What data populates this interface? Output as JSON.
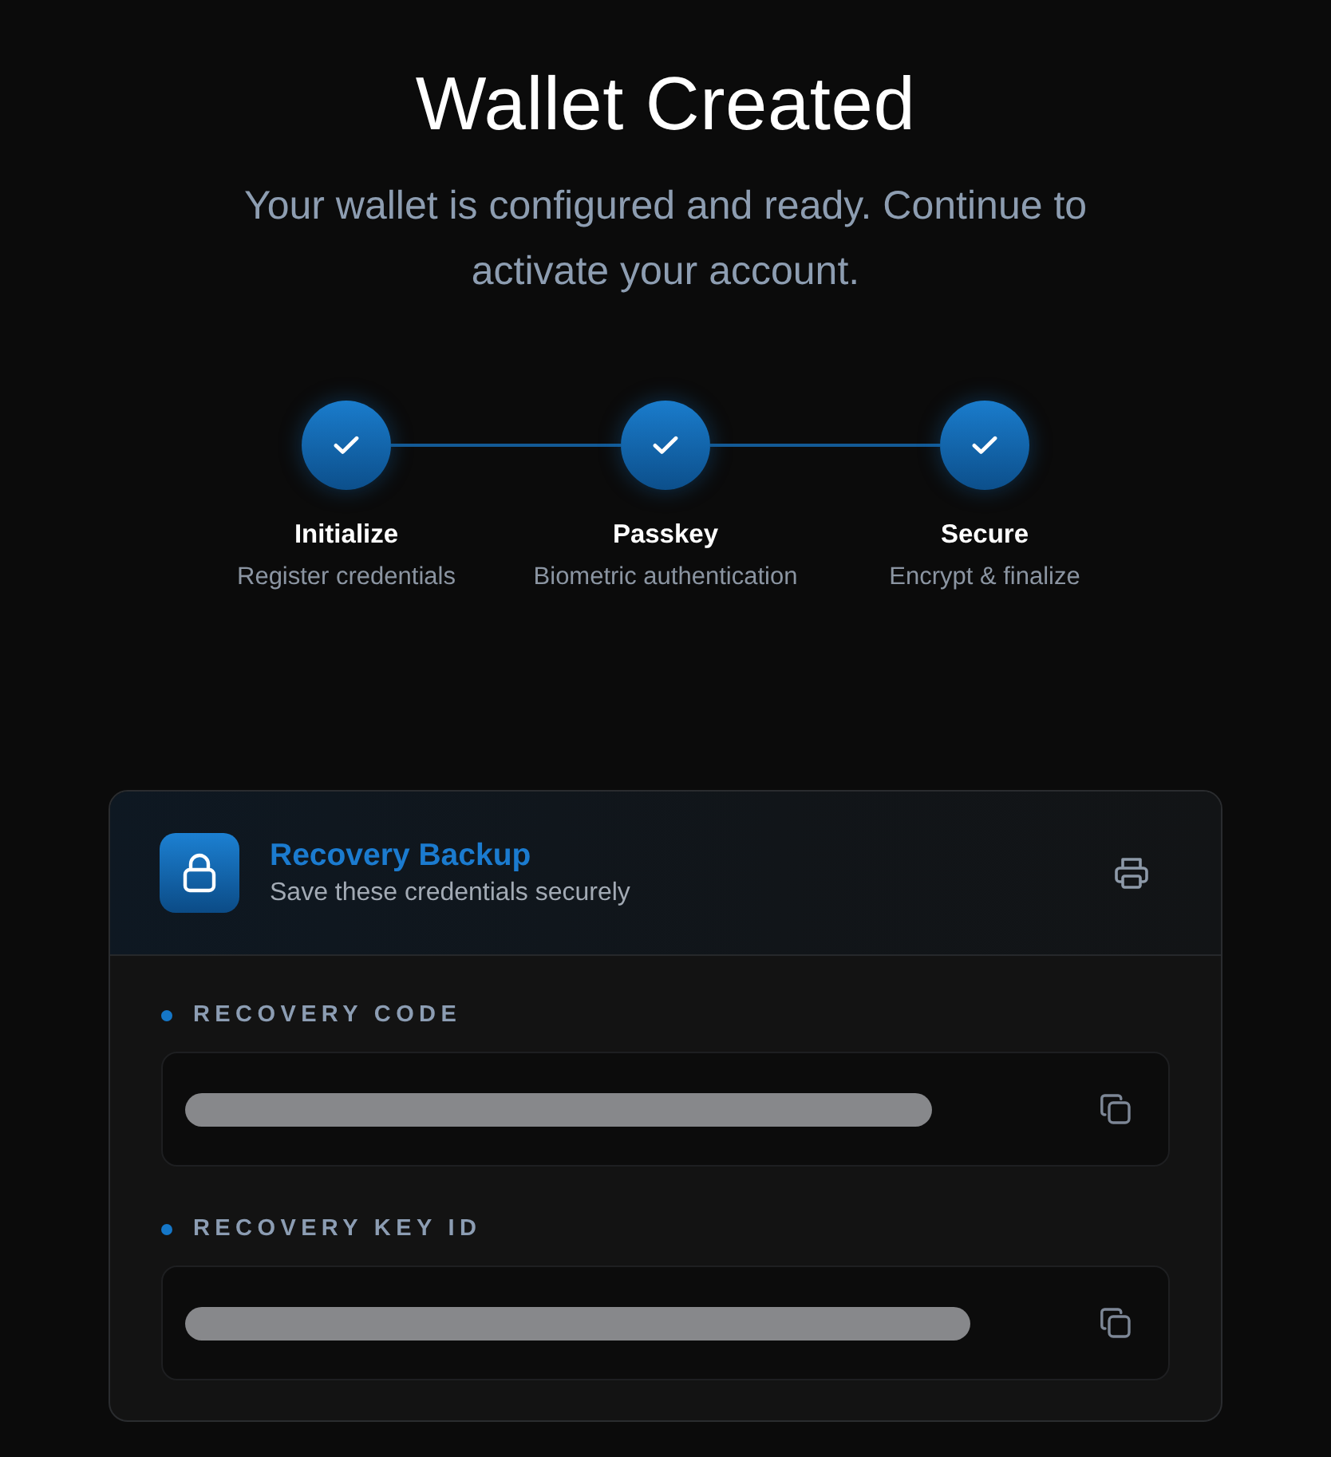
{
  "header": {
    "title": "Wallet Created",
    "subtitle": "Your wallet is configured and ready. Continue to activate your account."
  },
  "steps": [
    {
      "label": "Initialize",
      "description": "Register credentials",
      "completed": true
    },
    {
      "label": "Passkey",
      "description": "Biometric authentication",
      "completed": true
    },
    {
      "label": "Secure",
      "description": "Encrypt & finalize",
      "completed": true
    }
  ],
  "recovery_card": {
    "title": "Recovery Backup",
    "subtitle": "Save these credentials securely",
    "fields": [
      {
        "label": "RECOVERY CODE",
        "redacted": true
      },
      {
        "label": "RECOVERY KEY ID",
        "redacted": true
      }
    ]
  }
}
